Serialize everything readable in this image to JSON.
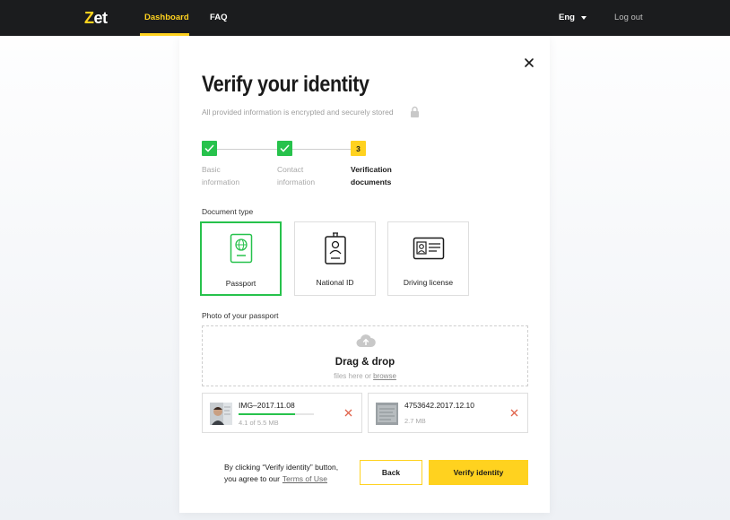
{
  "nav": {
    "logo": "Zet",
    "items": [
      {
        "label": "Dashboard",
        "active": true
      },
      {
        "label": "FAQ",
        "active": false
      }
    ],
    "language": "Eng",
    "logout": "Log out"
  },
  "modal": {
    "title": "Verify your identity",
    "subtitle": "All provided information is encrypted and securely stored",
    "steps": [
      {
        "number": "1",
        "label_line1": "Basic",
        "label_line2": "information",
        "status": "done"
      },
      {
        "number": "2",
        "label_line1": "Contact",
        "label_line2": "information",
        "status": "done"
      },
      {
        "number": "3",
        "label_line1": "Verification",
        "label_line2": "documents",
        "status": "current"
      }
    ],
    "document_type_label": "Document type",
    "document_types": [
      {
        "label": "Passport",
        "icon": "passport-icon",
        "selected": true
      },
      {
        "label": "National ID",
        "icon": "id-badge-icon",
        "selected": false
      },
      {
        "label": "Driving license",
        "icon": "driving-license-icon",
        "selected": false
      }
    ],
    "photo_label": "Photo of your passport",
    "dropzone": {
      "title": "Drag & drop",
      "sub_prefix": "files here or",
      "browse": "browse",
      "icon": "cloud-upload-icon"
    },
    "files": [
      {
        "name": "IMG–2017.11.08",
        "size": "4.1 of 5.5 MB",
        "progress": 0.75,
        "uploading": true
      },
      {
        "name": "4753642.2017.12.10",
        "size": "2.7 MB",
        "progress": 1.0,
        "uploading": false
      }
    ],
    "consent_line1": "By clicking “Verify identity” button,",
    "consent_line2": "you agree to our",
    "terms_link": "Terms of Use",
    "back_button": "Back",
    "verify_button": "Verify identity"
  },
  "colors": {
    "accent": "#ffd21f",
    "success": "#27c24c",
    "danger": "#e0624a",
    "topbar": "#1b1c1e"
  }
}
